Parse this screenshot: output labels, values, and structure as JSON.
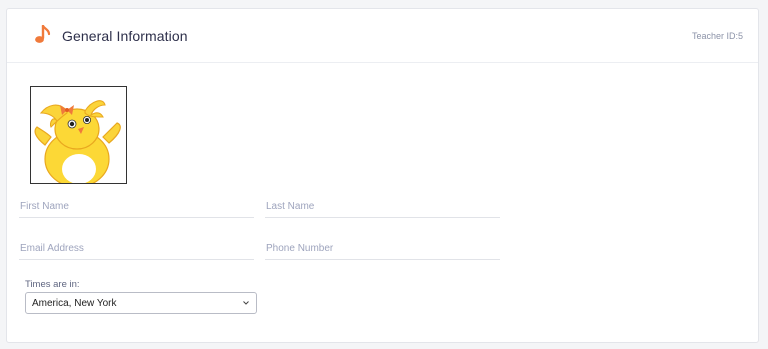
{
  "header": {
    "title": "General Information",
    "teacher_id": "Teacher ID:5",
    "icon": "music-note-icon"
  },
  "avatar": {
    "icon": "chick-avatar-icon"
  },
  "form": {
    "first_name": {
      "placeholder": "First Name",
      "value": ""
    },
    "last_name": {
      "placeholder": "Last Name",
      "value": ""
    },
    "email": {
      "placeholder": "Email Address",
      "value": ""
    },
    "phone": {
      "placeholder": "Phone Number",
      "value": ""
    },
    "timezone": {
      "label": "Times are in:",
      "selected": "America, New York"
    }
  },
  "colors": {
    "accent": "#f07a3b",
    "title": "#2d2f4a",
    "placeholder": "#9ea4bd"
  }
}
